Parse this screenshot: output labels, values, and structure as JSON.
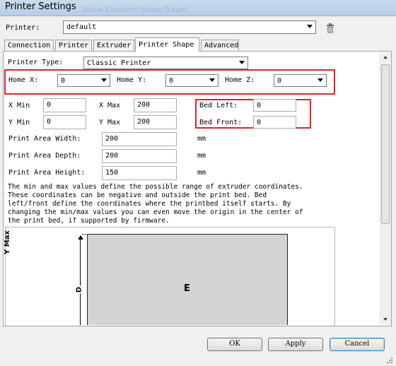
{
  "window": {
    "title": "Printer Settings",
    "ghost_text": "Show Element   Show Travel"
  },
  "printer": {
    "label": "Printer:",
    "value": "default"
  },
  "tabs": [
    {
      "label": "Connection"
    },
    {
      "label": "Printer"
    },
    {
      "label": "Extruder"
    },
    {
      "label": "Printer Shape"
    },
    {
      "label": "Advanced"
    }
  ],
  "printer_type": {
    "label": "Printer Type:",
    "value": "Classic Printer"
  },
  "home": {
    "x": {
      "label": "Home X:",
      "value": "0"
    },
    "y": {
      "label": "Home Y:",
      "value": "0"
    },
    "z": {
      "label": "Home Z:",
      "value": "0"
    }
  },
  "limits": {
    "xmin": {
      "label": "X Min",
      "value": "0"
    },
    "xmax": {
      "label": "X Max",
      "value": "200"
    },
    "ymin": {
      "label": "Y Min",
      "value": "0"
    },
    "ymax": {
      "label": "Y Max",
      "value": "200"
    }
  },
  "bed": {
    "left": {
      "label": "Bed Left:",
      "value": "0"
    },
    "front": {
      "label": "Bed Front:",
      "value": "0"
    }
  },
  "area": {
    "width": {
      "label": "Print Area Width:",
      "value": "200",
      "unit": "mm"
    },
    "depth": {
      "label": "Print Area Depth:",
      "value": "200",
      "unit": "mm"
    },
    "height": {
      "label": "Print Area Height:",
      "value": "150",
      "unit": "mm"
    }
  },
  "description": [
    "The min and max values define the possible range of extruder coordinates.",
    "These coordinates can be negative and outside the print bed. Bed",
    "left/front define the coordinates where the printbed itself starts. By",
    "changing the min/max values you can even move the origin in the center of",
    "the print bed, if supported by firmware."
  ],
  "diagram": {
    "ymax_label": "Y Max",
    "d_label": "D",
    "e_label": "E"
  },
  "buttons": {
    "ok": "OK",
    "apply": "Apply",
    "cancel": "Cancel"
  },
  "icons": {
    "delete": "trash-icon",
    "dropdown": "chevron-down-icon"
  },
  "colors": {
    "highlight": "#e8202a",
    "bed": "#d3d3d3"
  }
}
